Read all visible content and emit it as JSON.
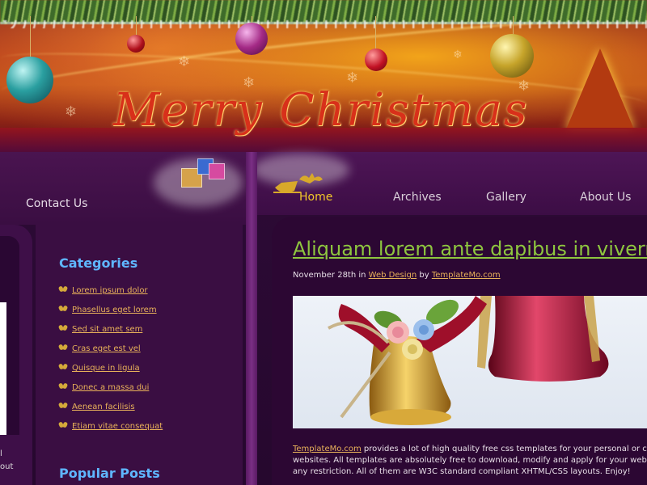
{
  "header": {
    "headline": "Merry Christmas"
  },
  "nav": {
    "contact": "Contact Us",
    "items": [
      {
        "label": "Home",
        "active": true
      },
      {
        "label": "Archives",
        "active": false
      },
      {
        "label": "Gallery",
        "active": false
      },
      {
        "label": "About Us",
        "active": false
      }
    ]
  },
  "left_cut": {
    "line1": "l",
    "line2": "out"
  },
  "sidebar": {
    "categories_title": "Categories",
    "categories": [
      "Lorem ipsum dolor",
      "Phasellus eget lorem",
      "Sed sit amet sem",
      "Cras eget est vel",
      "Quisque in ligula",
      "Donec a massa dui",
      "Aenean facilisis",
      "Etiam vitae consequat"
    ],
    "popular_title": "Popular Posts"
  },
  "post": {
    "title": "Aliquam lorem ante dapibus in viverra",
    "meta_date": "November 28th in",
    "meta_category": "Web Design",
    "meta_by": "by",
    "meta_author": "TemplateMo.com",
    "body_link": "TemplateMo.com",
    "body_line1": " provides a lot of high quality free css templates for your personal or commercial",
    "body_line2": "websites. All templates are absolutely free to download, modify and apply for your websites with",
    "body_line3": "any restriction. All of them are W3C standard compliant XHTML/CSS layouts. Enjoy!"
  },
  "colors": {
    "accent_gold": "#e9b25a",
    "nav_active": "#f2c82a",
    "title_green": "#8ec63f",
    "heading_blue": "#5fb6ff",
    "background_purple": "#3a0e42"
  },
  "icons": [
    "ornament-icon",
    "snowflake-icon",
    "christmas-tree-icon",
    "gift-box-icon",
    "sleigh-icon",
    "leaf-bullet-icon",
    "bell-image"
  ]
}
